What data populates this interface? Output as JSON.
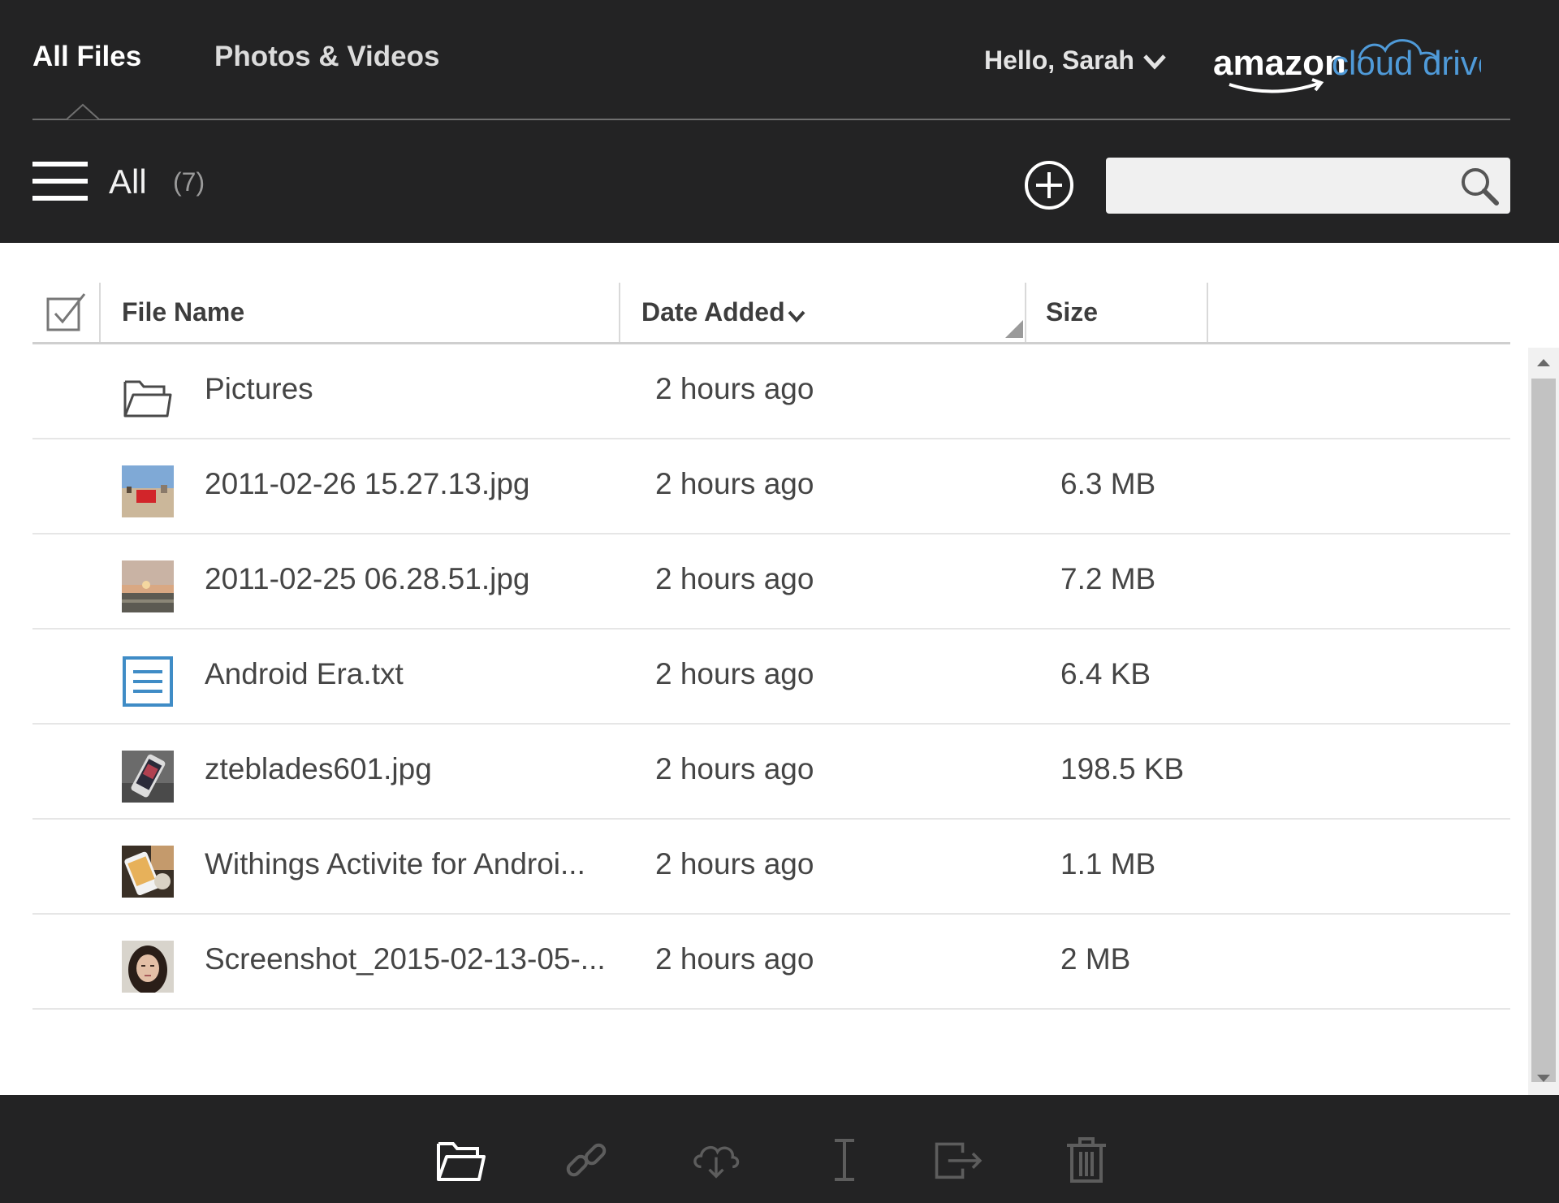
{
  "header": {
    "tabs": [
      {
        "label": "All Files",
        "active": true
      },
      {
        "label": "Photos & Videos",
        "active": false
      }
    ],
    "greeting": "Hello, Sarah",
    "logo": {
      "word": "amazon",
      "product": "cloud drive"
    }
  },
  "toolbar_top": {
    "filter_label": "All",
    "filter_count": "(7)",
    "search": {
      "value": "",
      "placeholder": ""
    }
  },
  "table": {
    "columns": {
      "name": "File Name",
      "date": "Date Added",
      "size": "Size"
    },
    "sort": {
      "column": "Date Added",
      "direction": "descending"
    },
    "rows": [
      {
        "name": "Pictures",
        "date": "2 hours ago",
        "size": "",
        "icon": "folder-icon"
      },
      {
        "name": "2011-02-26 15.27.13.jpg",
        "date": "2 hours ago",
        "size": "6.3 MB",
        "icon": "beach-photo-thumbnail"
      },
      {
        "name": "2011-02-25 06.28.51.jpg",
        "date": "2 hours ago",
        "size": "7.2 MB",
        "icon": "sunset-photo-thumbnail"
      },
      {
        "name": "Android Era.txt",
        "date": "2 hours ago",
        "size": "6.4 KB",
        "icon": "text-document-icon"
      },
      {
        "name": "zteblades601.jpg",
        "date": "2 hours ago",
        "size": "198.5 KB",
        "icon": "phone-photo-thumbnail"
      },
      {
        "name": "Withings Activite for Androi...",
        "date": "2 hours ago",
        "size": "1.1 MB",
        "icon": "watch-photo-thumbnail"
      },
      {
        "name": "Screenshot_2015-02-13-05-...",
        "date": "2 hours ago",
        "size": "2 MB",
        "icon": "portrait-photo-thumbnail"
      }
    ]
  },
  "actions": [
    {
      "icon": "open-folder-icon",
      "enabled": true
    },
    {
      "icon": "link-icon",
      "enabled": false
    },
    {
      "icon": "cloud-download-icon",
      "enabled": false
    },
    {
      "icon": "rename-cursor-icon",
      "enabled": false
    },
    {
      "icon": "move-icon",
      "enabled": false
    },
    {
      "icon": "trash-icon",
      "enabled": false
    }
  ],
  "colors": {
    "header_bg": "#232324",
    "logo_accent": "#4f9ad8",
    "text_icon_accent": "#3f8cc6"
  }
}
